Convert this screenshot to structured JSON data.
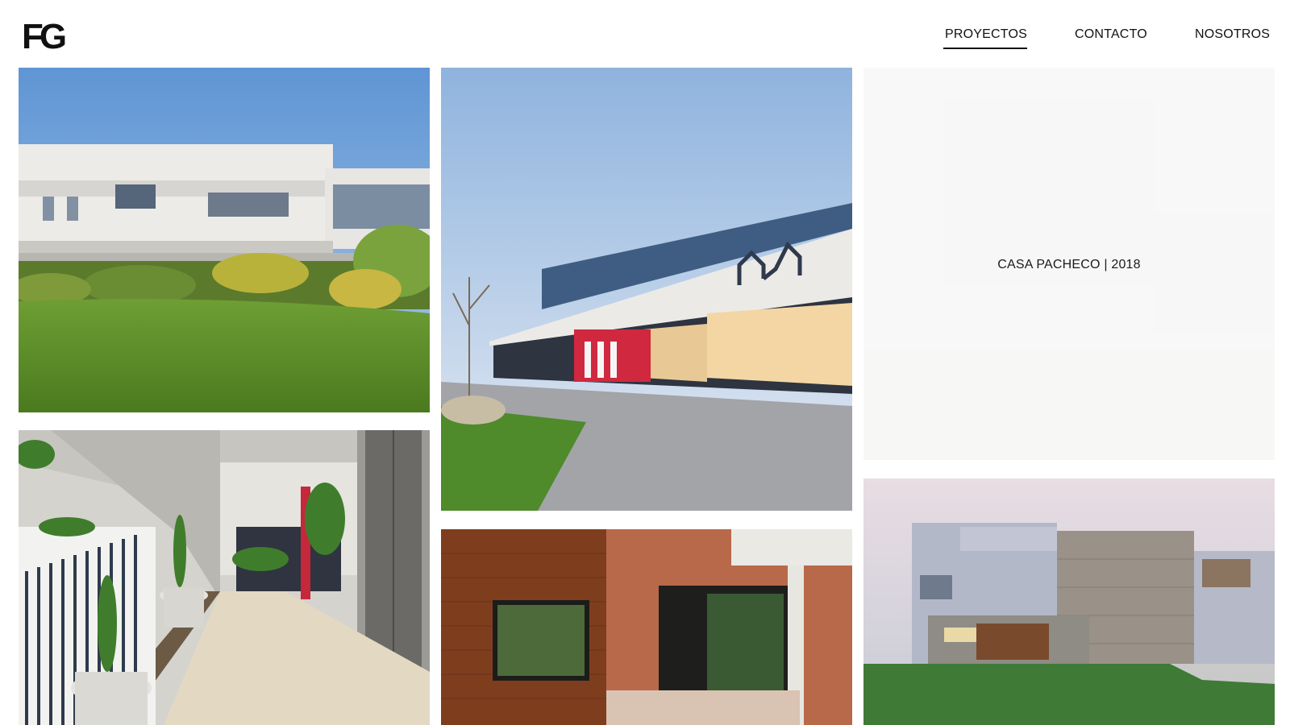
{
  "header": {
    "logo_text": "FG",
    "nav": [
      {
        "label": "PROYECTOS",
        "active": true
      },
      {
        "label": "CONTACTO",
        "active": false
      },
      {
        "label": "NOSOTROS",
        "active": false
      }
    ]
  },
  "gallery": {
    "hovered_project_caption": "CASA PACHECO | 2018",
    "colors": {
      "text": "#111111",
      "overlay": "#fafafa",
      "accent_red": "#d0283f"
    }
  }
}
